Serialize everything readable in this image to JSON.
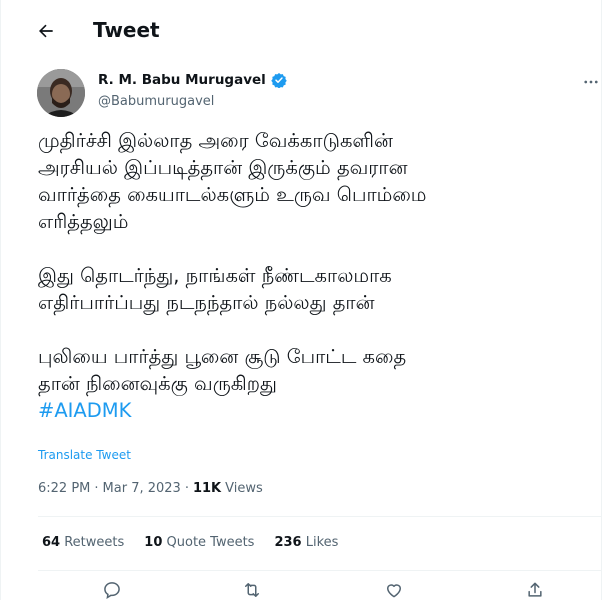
{
  "header": {
    "title": "Tweet",
    "back_icon": "arrow-left-icon"
  },
  "author": {
    "display_name": "R. M. Babu Murugavel",
    "handle": "@Babumurugavel",
    "verified": true,
    "verified_color": "#1d9bf0"
  },
  "tweet": {
    "paragraphs": [
      [
        "முதிர்ச்சி இல்லாத அரை வேக்காடுகளின்",
        "அரசியல் இப்படித்தான் இருக்கும் தவரான",
        "வார்த்தை கையாடல்களும் உருவ பொம்மை",
        "எரித்தலும்"
      ],
      [
        "இது தொடர்ந்து, நாங்கள் நீண்டகாலமாக",
        "எதிர்பார்ப்பது நடநந்தால் நல்லது தான்"
      ],
      [
        "புலியை பார்த்து பூனை சூடு போட்ட கதை",
        "தான் நினைவுக்கு வருகிறது"
      ]
    ],
    "hashtag": "#AIADMK",
    "hashtag_color": "#1d9bf0"
  },
  "translate_label": "Translate Tweet",
  "meta": {
    "time": "6:22 PM",
    "separator": "·",
    "date": "Mar 7, 2023",
    "views_count": "11K",
    "views_label": "Views"
  },
  "stats": {
    "retweets_count": "64",
    "retweets_label": "Retweets",
    "quotes_count": "10",
    "quotes_label": "Quote Tweets",
    "likes_count": "236",
    "likes_label": "Likes"
  },
  "actions": [
    "reply-icon",
    "retweet-icon",
    "like-icon",
    "share-icon"
  ]
}
